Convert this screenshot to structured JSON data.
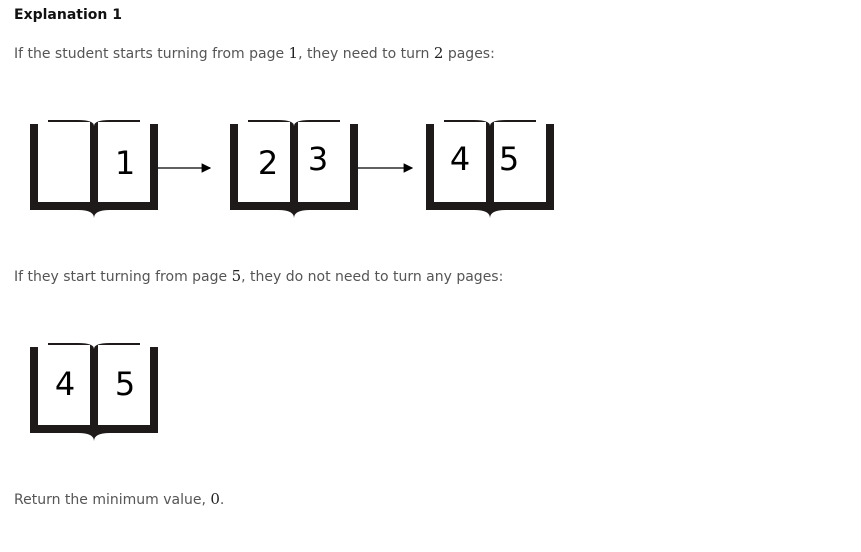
{
  "heading": "Explanation 1",
  "para1": {
    "before": "If the student starts turning from page ",
    "page": "1",
    "middle": ", they need to turn ",
    "count": "2",
    "after": " pages:"
  },
  "sequence1": {
    "books": [
      {
        "left": "",
        "right": "1"
      },
      {
        "left": "2",
        "right": "3"
      },
      {
        "left": "4",
        "right": "5"
      }
    ]
  },
  "para2": {
    "before": "If they start turning from page ",
    "page": "5",
    "after": ", they do not need to turn any pages:"
  },
  "sequence2": {
    "books": [
      {
        "left": "4",
        "right": "5"
      }
    ]
  },
  "para3": {
    "before": "Return the minimum value, ",
    "value": "0",
    "after": "."
  }
}
